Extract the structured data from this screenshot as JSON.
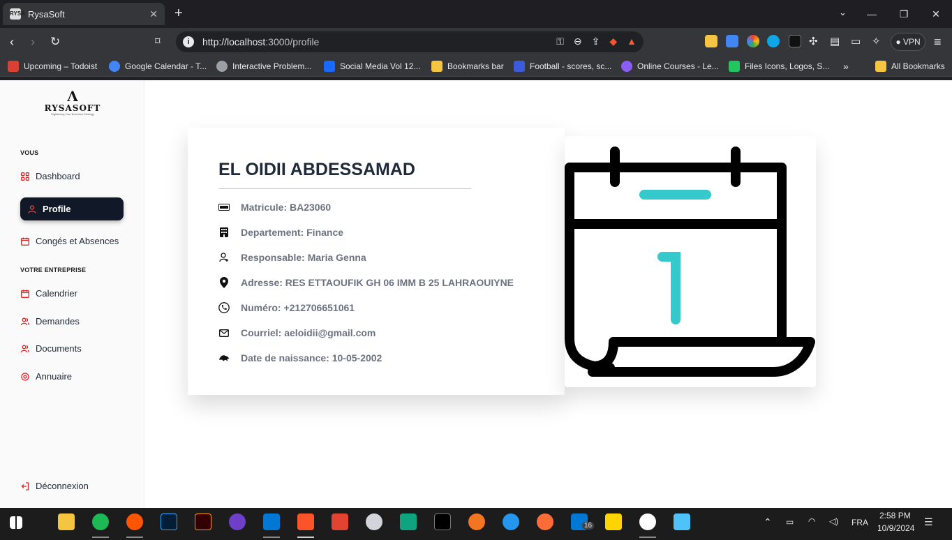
{
  "browser": {
    "tab_title": "RysaSoft",
    "favicon_text": "RYSA",
    "new_tab": "+",
    "url_host": "http://localhost",
    "url_path": ":3000/profile",
    "vpn_label": "VPN",
    "window_controls": [
      "⌄",
      "—",
      "❐",
      "✕"
    ]
  },
  "bookmarks": [
    {
      "label": "Upcoming – Todoist",
      "color": "#db4035"
    },
    {
      "label": "Google Calendar - T...",
      "color": "#4285f4"
    },
    {
      "label": "Interactive Problem...",
      "color": "#9aa0a6"
    },
    {
      "label": "Social Media Vol 12...",
      "color": "#1769ff"
    },
    {
      "label": "Bookmarks bar",
      "color": "#f5c542"
    },
    {
      "label": "Football - scores, sc...",
      "color": "#3b5bdb"
    },
    {
      "label": "Online Courses - Le...",
      "color": "#8b5cf6"
    },
    {
      "label": "Files Icons, Logos, S...",
      "color": "#22c55e"
    },
    {
      "label": "All Bookmarks",
      "color": "#f5c542"
    }
  ],
  "sidebar": {
    "logo_mark": "Λ",
    "logo_text": "RYSASOFT",
    "logo_tagline": "Digitalizing Your Business Strategy",
    "section_you": "VOUS",
    "items_you": [
      {
        "label": "Dashboard",
        "icon": "grid-icon"
      },
      {
        "label": "Profile",
        "icon": "user-icon",
        "active": true
      },
      {
        "label": "Congés et Absences",
        "icon": "calendar-icon"
      }
    ],
    "section_company": "VOTRE ENTREPRISE",
    "items_company": [
      {
        "label": "Calendrier",
        "icon": "calendar-icon"
      },
      {
        "label": "Demandes",
        "icon": "users-icon"
      },
      {
        "label": "Documents",
        "icon": "users-icon"
      },
      {
        "label": "Annuaire",
        "icon": "target-icon"
      }
    ],
    "logout": "Déconnexion",
    "accent": "#dc2626"
  },
  "profile": {
    "name": "EL OIDII ABDESSAMAD",
    "fields": [
      {
        "label": "Matricule: BA23060",
        "icon": "id-card-icon"
      },
      {
        "label": "Departement: Finance",
        "icon": "building-icon"
      },
      {
        "label": "Responsable: Maria Genna",
        "icon": "manager-icon"
      },
      {
        "label": "Adresse: RES ETTAOUFIK GH 06 IMM B 25 LAHRAOUIYNE",
        "icon": "location-pin-icon"
      },
      {
        "label": "Numéro: +212706651061",
        "icon": "phone-icon"
      },
      {
        "label": "Courriel: aeloidii@gmail.com",
        "icon": "envelope-icon"
      },
      {
        "label": "Date de naissance: 10-05-2002",
        "icon": "cake-icon"
      }
    ],
    "calendar_illustration_day": "1",
    "calendar_accent": "#35c9cc"
  },
  "taskbar": {
    "language": "FRA",
    "time": "2:58 PM",
    "date": "10/9/2024",
    "badge": "16"
  }
}
